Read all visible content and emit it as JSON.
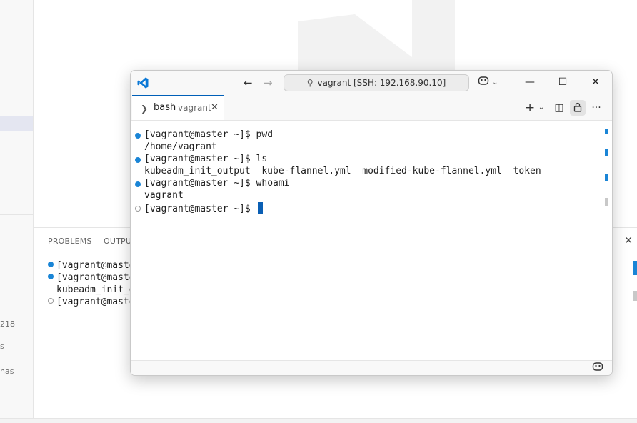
{
  "background_window": {
    "sidebar_fragments": [
      "218",
      "s",
      "has"
    ],
    "panel_tabs": [
      "PROBLEMS",
      "OUTPUT"
    ],
    "panel_lines": [
      {
        "dot": "filled",
        "text": "[vagrant@master ~"
      },
      {
        "dot": "filled",
        "text": "[vagrant@master ~"
      },
      {
        "dot": "none",
        "text": "kubeadm_init_outp"
      },
      {
        "dot": "empty",
        "text": "[vagrant@master ~"
      }
    ]
  },
  "terminal_window": {
    "title_search": "vagrant [SSH: 192.168.90.10]",
    "nav": {
      "back": "←",
      "forward": "→"
    },
    "window_controls": {
      "minimize": "—",
      "maximize": "☐",
      "close": "✕"
    },
    "tab": {
      "icon": "❯",
      "name": "bash",
      "subtitle": "vagrant",
      "close": "✕"
    },
    "toolbar": {
      "new_terminal": "+",
      "dropdown": "⌄",
      "split": "◫",
      "more": "···"
    },
    "lines": [
      {
        "dot": "filled",
        "prompt": "[vagrant@master ~]$ ",
        "command": "pwd"
      },
      {
        "dot": "none",
        "output": "/home/vagrant"
      },
      {
        "dot": "filled",
        "prompt": "[vagrant@master ~]$ ",
        "command": "ls"
      },
      {
        "dot": "none",
        "output": "kubeadm_init_output  kube-flannel.yml  modified-kube-flannel.yml  token"
      },
      {
        "dot": "filled",
        "prompt": "[vagrant@master ~]$ ",
        "command": "whoami"
      },
      {
        "dot": "none",
        "output": "vagrant"
      },
      {
        "dot": "empty",
        "prompt": "[vagrant@master ~]$ ",
        "command": ""
      }
    ]
  },
  "colors": {
    "accent": "#005fb8",
    "command_dot": "#1a85d6",
    "cursor": "#0a5fb4"
  },
  "icons": {
    "vscode_logo": "vscode-logo-icon",
    "search": "search-icon",
    "copilot": "copilot-icon",
    "lock": "lock-icon"
  }
}
